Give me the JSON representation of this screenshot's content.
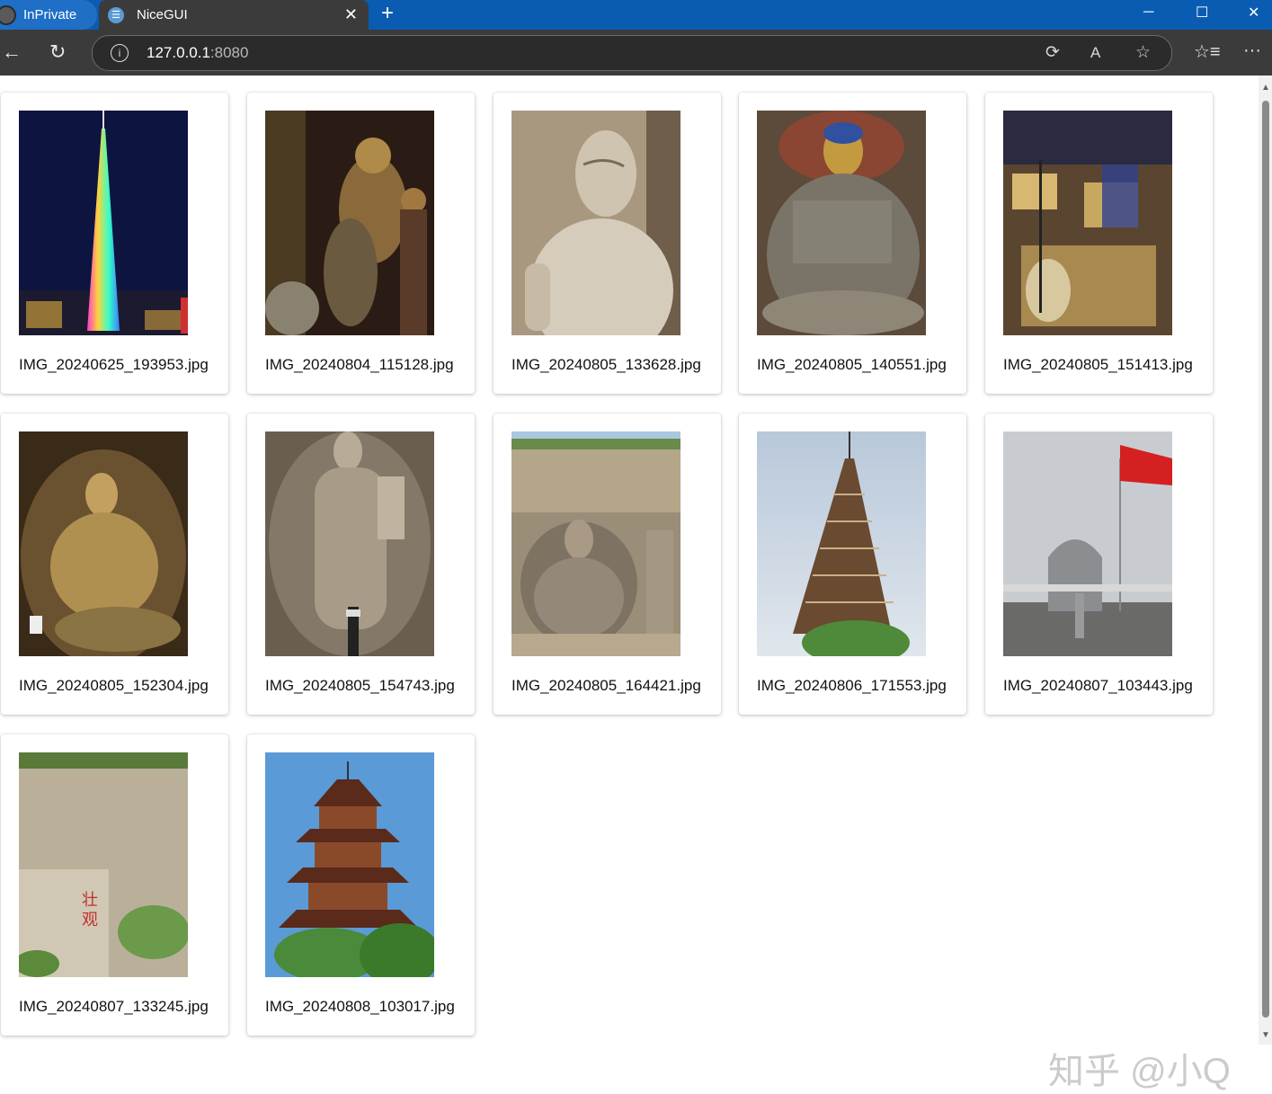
{
  "browser": {
    "inprivate_label": "InPrivate",
    "tab_title": "NiceGUI",
    "url_host": "127.0.0.1",
    "url_port": ":8080"
  },
  "gallery": [
    {
      "file": "IMG_20240625_193953.jpg",
      "subject": "Canton Tower at night"
    },
    {
      "file": "IMG_20240804_115128.jpg",
      "subject": "Golden temple statues"
    },
    {
      "file": "IMG_20240805_133628.jpg",
      "subject": "Stone Buddha relief"
    },
    {
      "file": "IMG_20240805_140551.jpg",
      "subject": "Seated Buddha in cave"
    },
    {
      "file": "IMG_20240805_151413.jpg",
      "subject": "Painted cave carvings"
    },
    {
      "file": "IMG_20240805_152304.jpg",
      "subject": "Lit seated Buddha"
    },
    {
      "file": "IMG_20240805_154743.jpg",
      "subject": "Standing Buddha"
    },
    {
      "file": "IMG_20240805_164421.jpg",
      "subject": "Cliff Buddha"
    },
    {
      "file": "IMG_20240806_171553.jpg",
      "subject": "Brick pagoda"
    },
    {
      "file": "IMG_20240807_103443.jpg",
      "subject": "Flag and stone tablet"
    },
    {
      "file": "IMG_20240807_133245.jpg",
      "subject": "Cliff with inscription"
    },
    {
      "file": "IMG_20240808_103017.jpg",
      "subject": "Wooden pagoda"
    }
  ],
  "watermark": "知乎 @小Q",
  "colors": {
    "titlebar": "#0a5cb3",
    "toolbar": "#3b3b3b"
  }
}
